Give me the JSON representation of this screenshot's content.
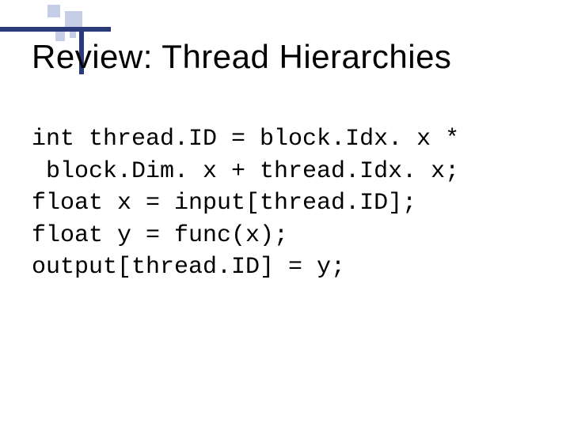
{
  "title": "Review:  Thread Hierarchies",
  "code": {
    "l1": "int thread.ID = block.Idx. x *",
    "l2": " block.Dim. x + thread.Idx. x;",
    "l3": "float x = input[thread.ID];",
    "l4": "float y = func(x);",
    "l5": "output[thread.ID] = y;"
  }
}
